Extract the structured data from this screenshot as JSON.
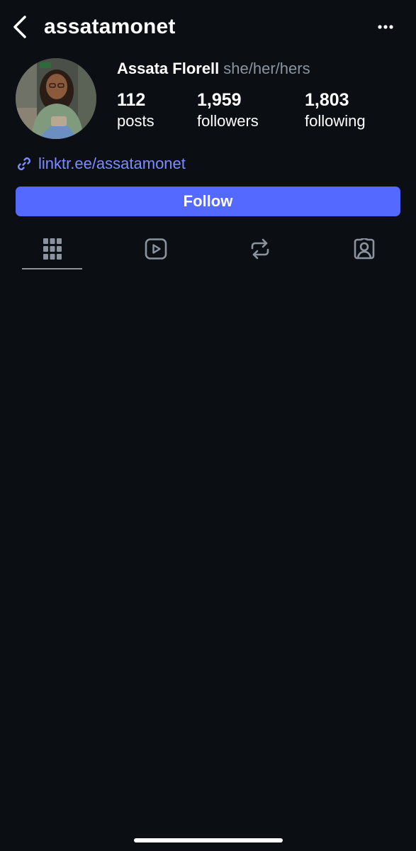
{
  "header": {
    "username": "assatamonet",
    "back_icon": "chevron-left-icon",
    "more_icon": "more-horizontal-icon"
  },
  "profile": {
    "display_name": "Assata Florell",
    "pronouns": "she/her/hers",
    "stats": [
      {
        "value": "112",
        "label": "posts"
      },
      {
        "value": "1,959",
        "label": "followers"
      },
      {
        "value": "1,803",
        "label": "following"
      }
    ],
    "link": "linktr.ee/assatamonet"
  },
  "actions": {
    "follow_label": "Follow"
  },
  "tabs": [
    {
      "icon": "grid-icon",
      "active": true
    },
    {
      "icon": "play-icon",
      "active": false
    },
    {
      "icon": "repost-icon",
      "active": false
    },
    {
      "icon": "tagged-person-icon",
      "active": false
    }
  ],
  "colors": {
    "background": "#0b0f14",
    "accent": "#5469ff",
    "link": "#7b8cff",
    "muted": "#8b949e"
  }
}
